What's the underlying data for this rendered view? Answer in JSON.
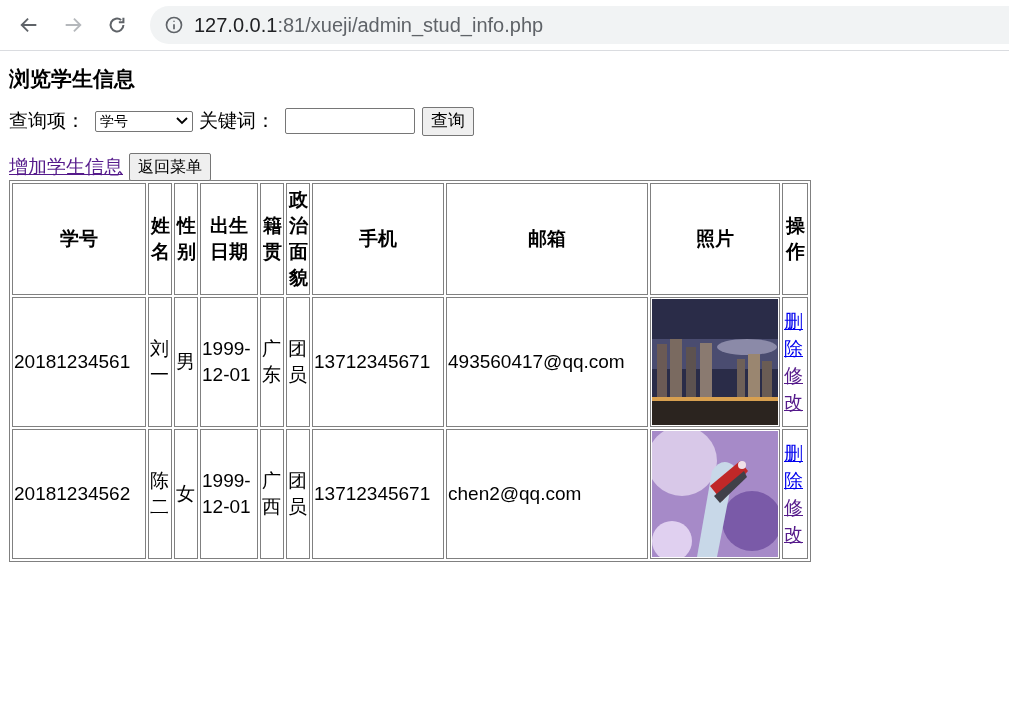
{
  "browser": {
    "url_host": "127.0.0.1",
    "url_rest": ":81/xueji/admin_stud_info.php",
    "forward_disabled": true
  },
  "page": {
    "title": "浏览学生信息",
    "query_label": "查询项：",
    "select_value": "学号",
    "keyword_label": "关键词：",
    "search_button": "查询",
    "add_link": {
      "label": "增加学生信息",
      "visited": true
    },
    "back_button": "返回菜单"
  },
  "table": {
    "columns": [
      "学号",
      "姓名",
      "性别",
      "出生日期",
      "籍贯",
      "政治面貌",
      "手机",
      "邮箱",
      "照片",
      "操作"
    ],
    "rows": [
      {
        "cells": [
          "20181234561",
          "刘一",
          "男",
          "1999-12-01",
          "广东",
          "团员",
          "13712345671",
          "493560417@qq.com"
        ],
        "actions": [
          {
            "label": "删除",
            "visited": false
          },
          {
            "label": "修改",
            "visited": true
          }
        ]
      },
      {
        "cells": [
          "20181234562",
          "陈二",
          "女",
          "1999-12-01",
          "广西",
          "团员",
          "13712345671",
          "chen2@qq.com"
        ],
        "actions": [
          {
            "label": "删除",
            "visited": false
          },
          {
            "label": "修改",
            "visited": true
          }
        ]
      }
    ]
  }
}
